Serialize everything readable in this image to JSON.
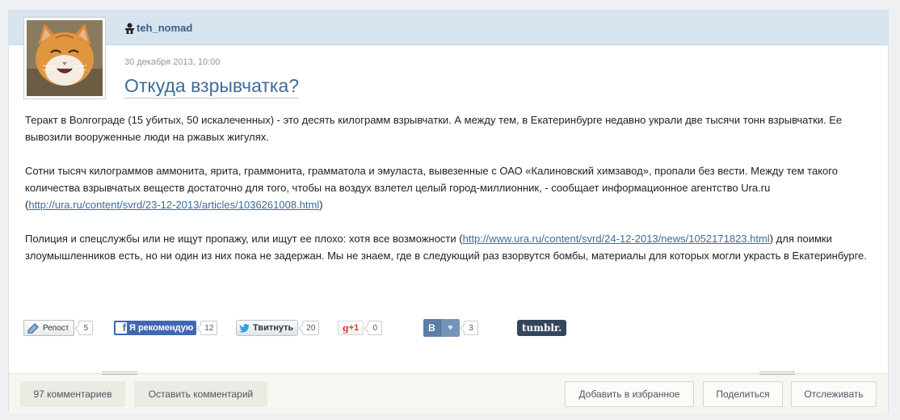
{
  "post": {
    "author": "teh_nomad",
    "author_icon": "user-icon",
    "date": "30 декабря 2013, 10:00",
    "title": "Откуда взрывчатка?",
    "paragraphs": [
      {
        "text_before": "Теракт в Волгограде (15 убитых, 50 искалеченных) - это десять килограмм взрывчатки. А между тем, в Екатеринбурге недавно украли две тысячи тонн взрывчатки. Ее вывозили вооруженные люди на ржавых жигулях.",
        "link": "",
        "text_after": ""
      },
      {
        "text_before": "Сотни тысяч килограммов аммонита, ярита, граммонита, грамматола и эмуласта, вывезенные с ОАО «Калиновский химзавод», пропали без вести. Между тем такого количества взрывчатых веществ достаточно для того, чтобы на воздух взлетел целый город-миллионник, - сообщает информационное агентство Ura.ru (",
        "link": "http://ura.ru/content/svrd/23-12-2013/articles/1036261008.html",
        "text_after": ")"
      },
      {
        "text_before": "Полиция и спецслужбы или не ищут пропажу, или ищут ее плохо: хотя все возможности (",
        "link": "http://www.ura.ru/content/svrd/24-12-2013/news/1052171823.html",
        "text_after": ") для поимки злоумышленников есть, но ни один из них пока не задержан. Мы не знаем, где в следующий раз взорвутся бомбы, материалы для которых могли украсть в Екатеринбурге."
      }
    ]
  },
  "share": {
    "repost_label": "Репост",
    "repost_count": "5",
    "facebook_label": "Я рекомендую",
    "facebook_count": "12",
    "twitter_label": "Твитнуть",
    "twitter_count": "20",
    "gplus_label": "+1",
    "gplus_count": "0",
    "vk_label": "В",
    "vk_count": "3",
    "tumblr_label": "tumblr."
  },
  "footer": {
    "comments_label": "97 комментариев",
    "leave_comment_label": "Оставить комментарий",
    "favorite_label": "Добавить в избранное",
    "share_label": "Поделиться",
    "track_label": "Отслеживать"
  },
  "colors": {
    "header_band": "#d6e4f0",
    "title": "#3d6b99",
    "link": "#3d6b99",
    "facebook": "#4267b2",
    "vk": "#5b7fa6",
    "tumblr": "#35465c",
    "gplus": "#d73d32"
  }
}
